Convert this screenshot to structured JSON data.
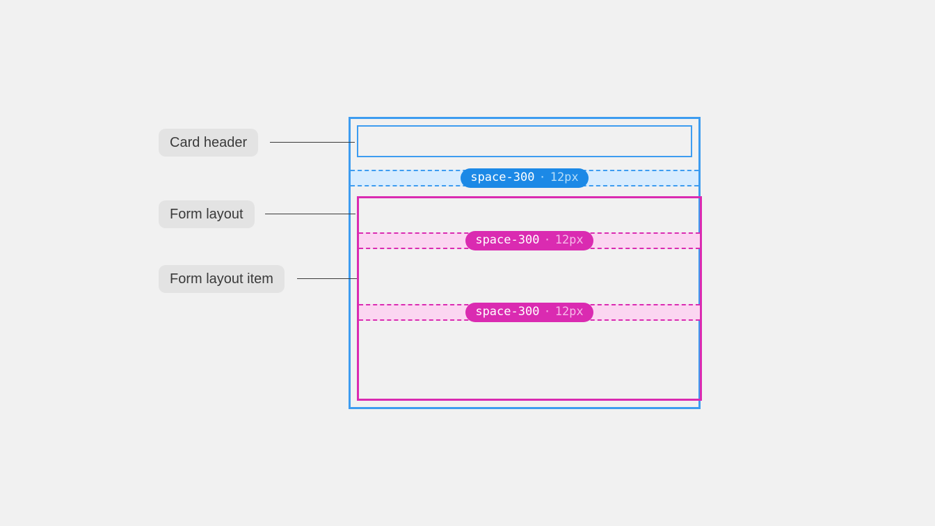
{
  "labels": {
    "card_header": "Card header",
    "form_layout": "Form layout",
    "form_layout_item": "Form layout item"
  },
  "spacing_tokens": {
    "card_gap": {
      "token": "space-300",
      "value": "12px"
    },
    "form_gap_1": {
      "token": "space-300",
      "value": "12px"
    },
    "form_gap_2": {
      "token": "space-300",
      "value": "12px"
    }
  },
  "colors": {
    "card_outline": "#3d9cf0",
    "form_outline": "#da2bb1",
    "gap_blue_fill": "#d8ecfe",
    "gap_pink_fill": "#fbd6f1",
    "label_bg": "#e3e3e3",
    "label_text": "#3a3a3a"
  }
}
